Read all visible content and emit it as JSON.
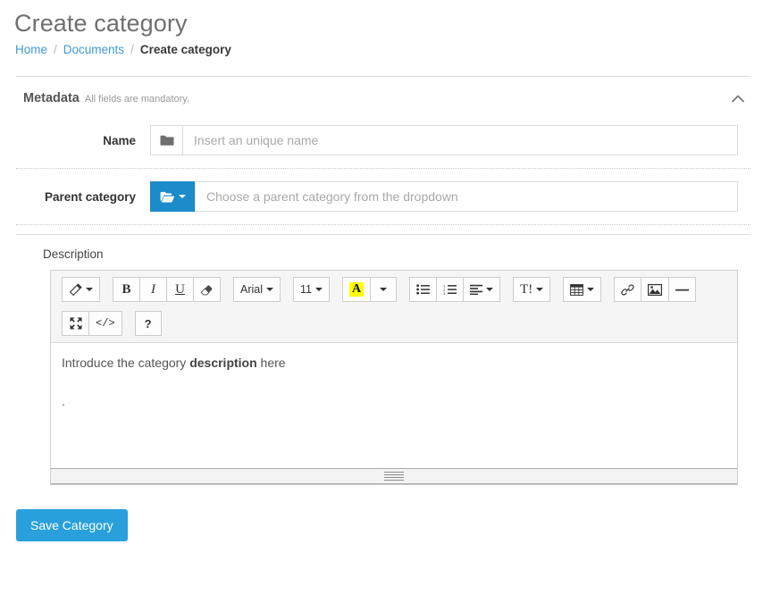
{
  "header": {
    "title": "Create category",
    "breadcrumb": [
      {
        "label": "Home",
        "type": "link"
      },
      {
        "label": "Documents",
        "type": "link"
      },
      {
        "label": "Create category",
        "type": "current"
      }
    ],
    "separator": "/"
  },
  "metadata_panel": {
    "title": "Metadata",
    "subtitle": "All fields are mandatory.",
    "collapse_icon": "chevron-up-icon"
  },
  "fields": {
    "name": {
      "label": "Name",
      "addon_icon": "folder-icon",
      "value": "",
      "placeholder": "Insert an unique name"
    },
    "parent_category": {
      "label": "Parent category",
      "dropdown_icon": "folder-open-icon",
      "dropdown_caret_icon": "caret-down-icon",
      "value": "",
      "placeholder": "Choose a parent category from the dropdown"
    }
  },
  "description": {
    "label": "Description",
    "content_line_1_prefix": "Introduce the category ",
    "content_line_1_bold": "description",
    "content_line_1_suffix": " here",
    "content_line_2": "."
  },
  "editor_toolbar": {
    "groups": [
      {
        "name": "style-group",
        "buttons": [
          {
            "name": "magic-wand-icon",
            "label": "",
            "has_caret": true
          }
        ]
      },
      {
        "name": "font-style-group",
        "buttons": [
          {
            "name": "bold-icon",
            "label": "B",
            "has_caret": false
          },
          {
            "name": "italic-icon",
            "label": "I",
            "has_caret": false
          },
          {
            "name": "underline-icon",
            "label": "U",
            "has_caret": false
          },
          {
            "name": "eraser-icon",
            "label": "",
            "has_caret": false
          }
        ]
      },
      {
        "name": "font-name-group",
        "buttons": [
          {
            "name": "font-family-dropdown",
            "label": "Arial",
            "has_caret": true
          }
        ]
      },
      {
        "name": "font-size-group",
        "buttons": [
          {
            "name": "font-size-dropdown",
            "label": "11",
            "has_caret": true
          }
        ]
      },
      {
        "name": "color-group",
        "buttons": [
          {
            "name": "recent-color-icon",
            "label": "A",
            "has_caret": false
          },
          {
            "name": "color-dropdown",
            "label": "",
            "has_caret": true
          }
        ]
      },
      {
        "name": "list-group",
        "buttons": [
          {
            "name": "unordered-list-icon",
            "label": "",
            "has_caret": false
          },
          {
            "name": "ordered-list-icon",
            "label": "",
            "has_caret": false
          },
          {
            "name": "paragraph-align-icon",
            "label": "",
            "has_caret": true
          }
        ]
      },
      {
        "name": "line-height-group",
        "buttons": [
          {
            "name": "line-height-icon",
            "label": "T!",
            "has_caret": true
          }
        ]
      },
      {
        "name": "table-group",
        "buttons": [
          {
            "name": "table-icon",
            "label": "",
            "has_caret": true
          }
        ]
      },
      {
        "name": "insert-group",
        "buttons": [
          {
            "name": "link-icon",
            "label": "",
            "has_caret": false
          },
          {
            "name": "picture-icon",
            "label": "",
            "has_caret": false
          },
          {
            "name": "horizontal-rule-icon",
            "label": "",
            "has_caret": false
          }
        ]
      },
      {
        "name": "view-group",
        "buttons": [
          {
            "name": "fullscreen-icon",
            "label": "",
            "has_caret": false
          },
          {
            "name": "code-view-icon",
            "label": "</>",
            "has_caret": false
          }
        ]
      },
      {
        "name": "help-group",
        "buttons": [
          {
            "name": "help-icon",
            "label": "?",
            "has_caret": false
          }
        ]
      }
    ],
    "highlight_color": "#ffff00"
  },
  "actions": {
    "save_label": "Save Category"
  },
  "colors": {
    "link": "#3e9ad6",
    "primary_button": "#29a0db",
    "dropdown_button": "#1b8bc9",
    "highlight": "#ffff00"
  }
}
